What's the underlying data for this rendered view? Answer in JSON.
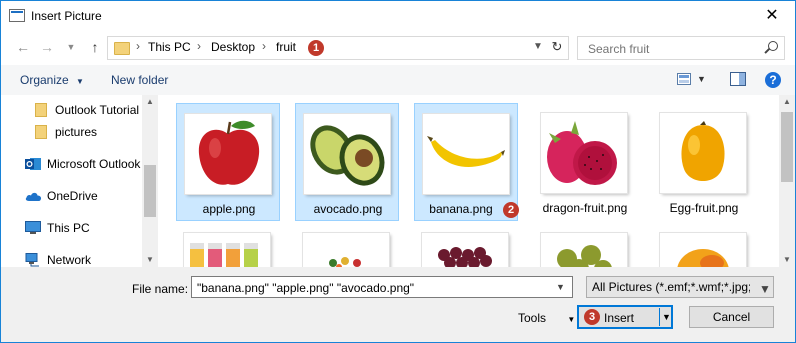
{
  "window": {
    "title": "Insert Picture",
    "close_glyph": "✕"
  },
  "address": {
    "crumbs": [
      "This PC",
      "Desktop",
      "fruit"
    ],
    "step_badge": "1"
  },
  "search": {
    "placeholder": "Search fruit"
  },
  "toolbar": {
    "organize_label": "Organize",
    "new_folder_label": "New folder",
    "help_label": "?"
  },
  "sidebar": {
    "items": [
      {
        "label": "Outlook Tutorial",
        "icon": "folder-icon"
      },
      {
        "label": "pictures",
        "icon": "folder-icon"
      },
      {
        "label": "Microsoft Outlook",
        "icon": "outlook-icon"
      },
      {
        "label": "OneDrive",
        "icon": "onedrive-icon"
      },
      {
        "label": "This PC",
        "icon": "computer-icon"
      },
      {
        "label": "Network",
        "icon": "network-icon"
      }
    ]
  },
  "files": [
    {
      "name": "apple.png",
      "selected": true
    },
    {
      "name": "avocado.png",
      "selected": true
    },
    {
      "name": "banana.png",
      "selected": true,
      "badge": "2"
    },
    {
      "name": "dragon-fruit.png",
      "selected": false
    },
    {
      "name": "Egg-fruit.png",
      "selected": false
    }
  ],
  "bottom": {
    "file_name_label": "File name:",
    "file_name_value": "\"banana.png\" \"apple.png\" \"avocado.png\"",
    "file_type_value": "All Pictures (*.emf;*.wmf;*.jpg;*",
    "tools_label": "Tools",
    "insert_label": "Insert",
    "insert_badge": "3",
    "cancel_label": "Cancel"
  },
  "colors": {
    "accent": "#0078d7",
    "badge": "#c0392b",
    "selection": "#cce8ff"
  }
}
